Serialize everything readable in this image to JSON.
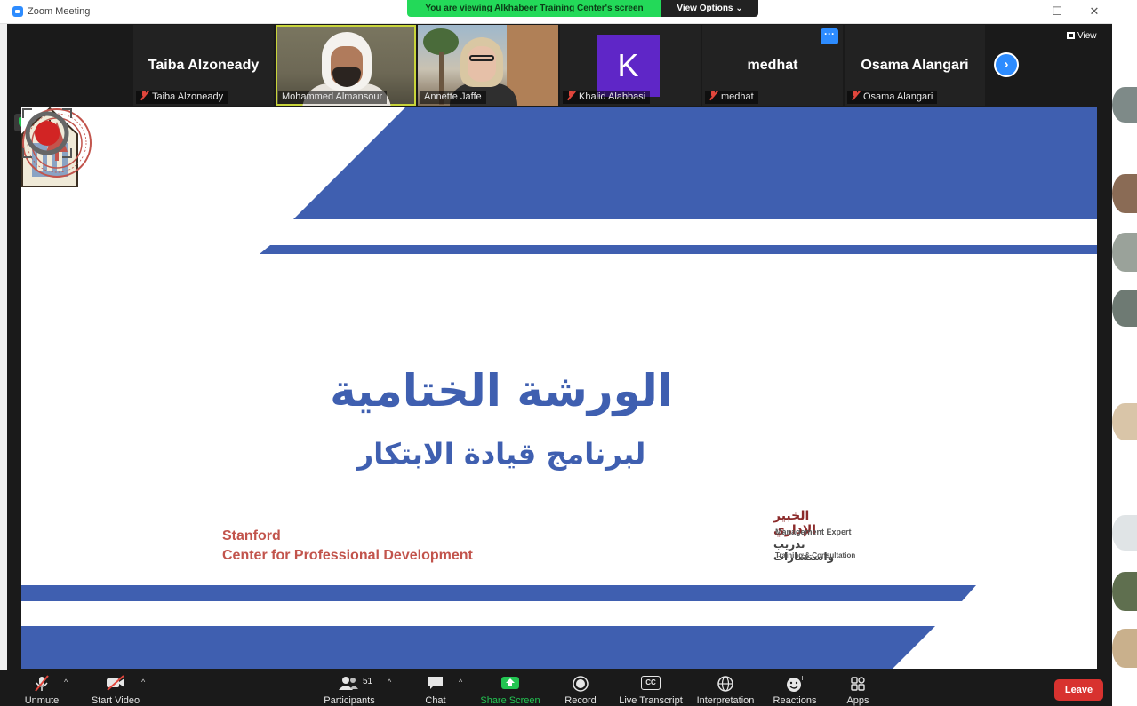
{
  "window": {
    "title": "Zoom Meeting",
    "share_banner": "You are viewing Alkhabeer Training Center's screen",
    "view_options": "View Options",
    "minimize": "—",
    "maximize": "☐",
    "close": "✕"
  },
  "gallery": {
    "view_label": "View",
    "more_glyph": "···",
    "next_glyph": "›",
    "tiles": [
      {
        "big_name": "Taiba Alzoneady",
        "label": "Taiba Alzoneady"
      },
      {
        "label": "Mohammed Almansour"
      },
      {
        "label": "Annette Jaffe"
      },
      {
        "avatar_letter": "K",
        "label": "Khalid Alabbasi"
      },
      {
        "big_name": "medhat",
        "label": "medhat"
      },
      {
        "big_name": "Osama Alangari",
        "label": "Osama Alangari"
      }
    ]
  },
  "slide": {
    "title_ar": "الورشة الختامية",
    "subtitle_ar": "لبرنامج قيادة الابتكار",
    "stanford_line1": "Stanford",
    "stanford_line2": "Center for Professional Development",
    "me_ar1": "الخبير الإداري",
    "me_en1": "Management Expert",
    "me_ar2": "تدريب واستشارات",
    "me_en2": "Training & Consultation",
    "brand_blue": "#3f5fb0"
  },
  "toolbar": {
    "unmute": "Unmute",
    "start_video": "Start Video",
    "participants": "Participants",
    "participants_count": "51",
    "chat": "Chat",
    "share_screen": "Share Screen",
    "record": "Record",
    "live_transcript": "Live Transcript",
    "cc": "CC",
    "interpretation": "Interpretation",
    "reactions": "Reactions",
    "apps": "Apps",
    "leave": "Leave"
  }
}
